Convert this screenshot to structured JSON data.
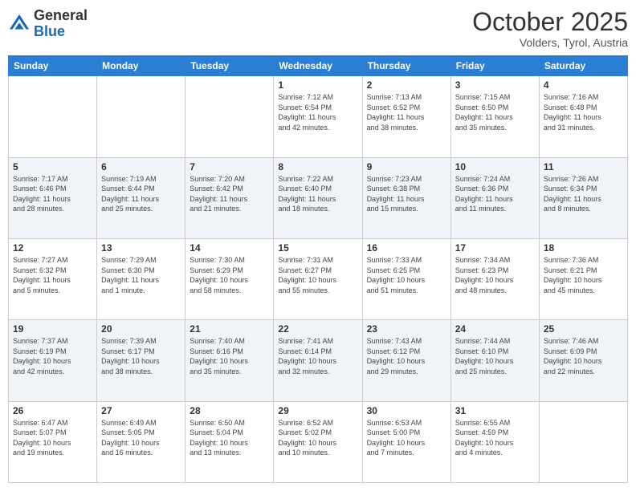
{
  "header": {
    "logo_general": "General",
    "logo_blue": "Blue",
    "month": "October 2025",
    "location": "Volders, Tyrol, Austria"
  },
  "weekdays": [
    "Sunday",
    "Monday",
    "Tuesday",
    "Wednesday",
    "Thursday",
    "Friday",
    "Saturday"
  ],
  "weeks": [
    [
      {
        "day": "",
        "info": ""
      },
      {
        "day": "",
        "info": ""
      },
      {
        "day": "",
        "info": ""
      },
      {
        "day": "1",
        "info": "Sunrise: 7:12 AM\nSunset: 6:54 PM\nDaylight: 11 hours\nand 42 minutes."
      },
      {
        "day": "2",
        "info": "Sunrise: 7:13 AM\nSunset: 6:52 PM\nDaylight: 11 hours\nand 38 minutes."
      },
      {
        "day": "3",
        "info": "Sunrise: 7:15 AM\nSunset: 6:50 PM\nDaylight: 11 hours\nand 35 minutes."
      },
      {
        "day": "4",
        "info": "Sunrise: 7:16 AM\nSunset: 6:48 PM\nDaylight: 11 hours\nand 31 minutes."
      }
    ],
    [
      {
        "day": "5",
        "info": "Sunrise: 7:17 AM\nSunset: 6:46 PM\nDaylight: 11 hours\nand 28 minutes."
      },
      {
        "day": "6",
        "info": "Sunrise: 7:19 AM\nSunset: 6:44 PM\nDaylight: 11 hours\nand 25 minutes."
      },
      {
        "day": "7",
        "info": "Sunrise: 7:20 AM\nSunset: 6:42 PM\nDaylight: 11 hours\nand 21 minutes."
      },
      {
        "day": "8",
        "info": "Sunrise: 7:22 AM\nSunset: 6:40 PM\nDaylight: 11 hours\nand 18 minutes."
      },
      {
        "day": "9",
        "info": "Sunrise: 7:23 AM\nSunset: 6:38 PM\nDaylight: 11 hours\nand 15 minutes."
      },
      {
        "day": "10",
        "info": "Sunrise: 7:24 AM\nSunset: 6:36 PM\nDaylight: 11 hours\nand 11 minutes."
      },
      {
        "day": "11",
        "info": "Sunrise: 7:26 AM\nSunset: 6:34 PM\nDaylight: 11 hours\nand 8 minutes."
      }
    ],
    [
      {
        "day": "12",
        "info": "Sunrise: 7:27 AM\nSunset: 6:32 PM\nDaylight: 11 hours\nand 5 minutes."
      },
      {
        "day": "13",
        "info": "Sunrise: 7:29 AM\nSunset: 6:30 PM\nDaylight: 11 hours\nand 1 minute."
      },
      {
        "day": "14",
        "info": "Sunrise: 7:30 AM\nSunset: 6:29 PM\nDaylight: 10 hours\nand 58 minutes."
      },
      {
        "day": "15",
        "info": "Sunrise: 7:31 AM\nSunset: 6:27 PM\nDaylight: 10 hours\nand 55 minutes."
      },
      {
        "day": "16",
        "info": "Sunrise: 7:33 AM\nSunset: 6:25 PM\nDaylight: 10 hours\nand 51 minutes."
      },
      {
        "day": "17",
        "info": "Sunrise: 7:34 AM\nSunset: 6:23 PM\nDaylight: 10 hours\nand 48 minutes."
      },
      {
        "day": "18",
        "info": "Sunrise: 7:36 AM\nSunset: 6:21 PM\nDaylight: 10 hours\nand 45 minutes."
      }
    ],
    [
      {
        "day": "19",
        "info": "Sunrise: 7:37 AM\nSunset: 6:19 PM\nDaylight: 10 hours\nand 42 minutes."
      },
      {
        "day": "20",
        "info": "Sunrise: 7:39 AM\nSunset: 6:17 PM\nDaylight: 10 hours\nand 38 minutes."
      },
      {
        "day": "21",
        "info": "Sunrise: 7:40 AM\nSunset: 6:16 PM\nDaylight: 10 hours\nand 35 minutes."
      },
      {
        "day": "22",
        "info": "Sunrise: 7:41 AM\nSunset: 6:14 PM\nDaylight: 10 hours\nand 32 minutes."
      },
      {
        "day": "23",
        "info": "Sunrise: 7:43 AM\nSunset: 6:12 PM\nDaylight: 10 hours\nand 29 minutes."
      },
      {
        "day": "24",
        "info": "Sunrise: 7:44 AM\nSunset: 6:10 PM\nDaylight: 10 hours\nand 25 minutes."
      },
      {
        "day": "25",
        "info": "Sunrise: 7:46 AM\nSunset: 6:09 PM\nDaylight: 10 hours\nand 22 minutes."
      }
    ],
    [
      {
        "day": "26",
        "info": "Sunrise: 6:47 AM\nSunset: 5:07 PM\nDaylight: 10 hours\nand 19 minutes."
      },
      {
        "day": "27",
        "info": "Sunrise: 6:49 AM\nSunset: 5:05 PM\nDaylight: 10 hours\nand 16 minutes."
      },
      {
        "day": "28",
        "info": "Sunrise: 6:50 AM\nSunset: 5:04 PM\nDaylight: 10 hours\nand 13 minutes."
      },
      {
        "day": "29",
        "info": "Sunrise: 6:52 AM\nSunset: 5:02 PM\nDaylight: 10 hours\nand 10 minutes."
      },
      {
        "day": "30",
        "info": "Sunrise: 6:53 AM\nSunset: 5:00 PM\nDaylight: 10 hours\nand 7 minutes."
      },
      {
        "day": "31",
        "info": "Sunrise: 6:55 AM\nSunset: 4:59 PM\nDaylight: 10 hours\nand 4 minutes."
      },
      {
        "day": "",
        "info": ""
      }
    ]
  ]
}
